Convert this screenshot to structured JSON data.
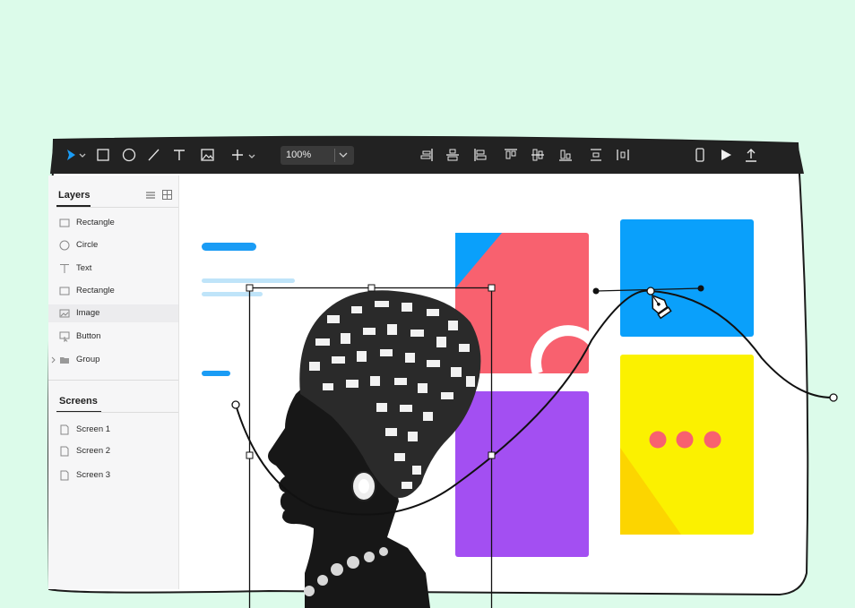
{
  "toolbar": {
    "zoom_value": "100%",
    "tools": [
      "select-tool",
      "rectangle-tool",
      "ellipse-tool",
      "line-tool",
      "text-tool",
      "image-tool",
      "add-tool"
    ],
    "align_tools": [
      "align-right",
      "align-top-center",
      "align-left",
      "align-top",
      "align-middle",
      "align-bottom",
      "distribute-vertical",
      "distribute-horizontal"
    ],
    "right_tools": [
      "device-preview",
      "play-preview",
      "export"
    ]
  },
  "layers_panel": {
    "title": "Layers",
    "items": [
      {
        "label": "Rectangle",
        "icon": "rectangle-icon"
      },
      {
        "label": "Circle",
        "icon": "circle-icon"
      },
      {
        "label": "Text",
        "icon": "text-icon"
      },
      {
        "label": "Rectangle",
        "icon": "rectangle-icon"
      },
      {
        "label": "Image",
        "icon": "image-icon",
        "selected": true
      },
      {
        "label": "Button",
        "icon": "button-icon"
      },
      {
        "label": "Group",
        "icon": "folder-icon"
      }
    ]
  },
  "screens_panel": {
    "title": "Screens",
    "items": [
      {
        "label": "Screen 1"
      },
      {
        "label": "Screen 2"
      },
      {
        "label": "Screen 3"
      }
    ]
  },
  "colors": {
    "background": "#dcfbea",
    "toolbar": "#222222",
    "accent": "#1a9cf5",
    "coral": "#f8616f",
    "blue": "#0aa0fb",
    "purple": "#a34ff2",
    "yellow": "#fbf100"
  }
}
